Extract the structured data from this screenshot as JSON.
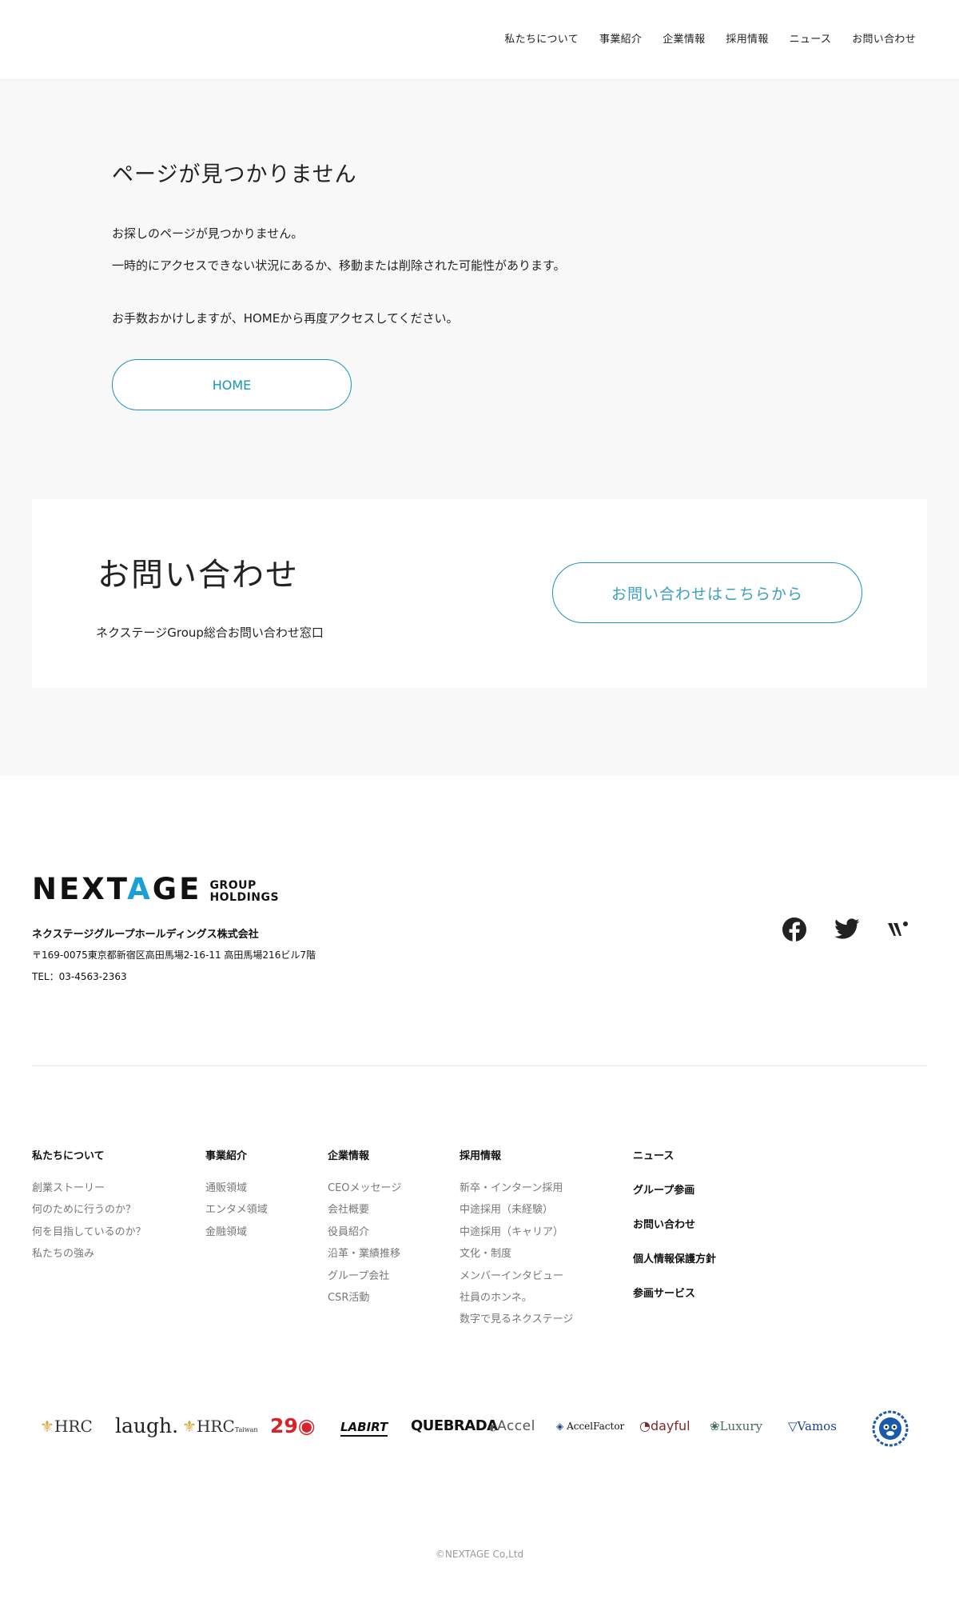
{
  "nav": [
    {
      "label": "私たちについて"
    },
    {
      "label": "事業紹介"
    },
    {
      "label": "企業情報"
    },
    {
      "label": "採用情報"
    },
    {
      "label": "ニュース"
    },
    {
      "label": "お問い合わせ"
    }
  ],
  "not_found": {
    "title": "ページが見つかりません",
    "line1": "お探しのページが見つかりません。",
    "line2": "一時的にアクセスできない状況にあるか、移動または削除された可能性があります。",
    "line3": "お手数おかけしますが、HOMEから再度アクセスしてください。",
    "home_label": "HOME"
  },
  "contact": {
    "title": "お問い合わせ",
    "subtitle": "ネクステージGroup総合お問い合わせ窓口",
    "button_label": "お問い合わせはこちらから"
  },
  "footer": {
    "logo_main_1": "NEXT",
    "logo_main_a": "A",
    "logo_main_2": "GE",
    "logo_sub_1": "GROUP",
    "logo_sub_2": "HOLDINGS",
    "company": "ネクステージグループホールディングス株式会社",
    "address": "〒169-0075東京都新宿区高田馬場2-16-11 高田馬場216ビル7階",
    "tel": "TEL：03-4563-2363",
    "columns": {
      "about": {
        "head": "私たちについて",
        "items": [
          "創業ストーリー",
          "何のために行うのか？",
          "何を目指しているのか？",
          "私たちの強み"
        ]
      },
      "business": {
        "head": "事業紹介",
        "items": [
          "通販領域",
          "エンタメ領域",
          "金融領域"
        ]
      },
      "corporate": {
        "head": "企業情報",
        "items": [
          "CEOメッセージ",
          "会社概要",
          "役員紹介",
          "沿革・業績推移",
          "グループ会社",
          "CSR活動"
        ]
      },
      "recruit": {
        "head": "採用情報",
        "items": [
          "新卒・インターン採用",
          "中途採用（未経験）",
          "中途採用（キャリア）",
          "文化・制度",
          "メンバーインタビュー",
          "社員のホンネ。",
          "数字で見るネクステージ"
        ]
      },
      "misc": [
        "ニュース",
        "グループ参画",
        "お問い合わせ",
        "個人情報保護方針",
        "参画サービス"
      ]
    },
    "brands": [
      "HRC",
      "laugh.",
      "HRC",
      "Taiwan",
      "29",
      "LABIRT",
      "QUEBRADA",
      "Accel",
      "AccelFactor",
      "dayful",
      "Luxury",
      "Vamos"
    ],
    "copyright": "©NEXTAGE Co,Ltd"
  },
  "colors": {
    "accent": "#1b95b8",
    "logo_accent": "#1b9fd6",
    "gray_bg": "#f8f8f8"
  }
}
